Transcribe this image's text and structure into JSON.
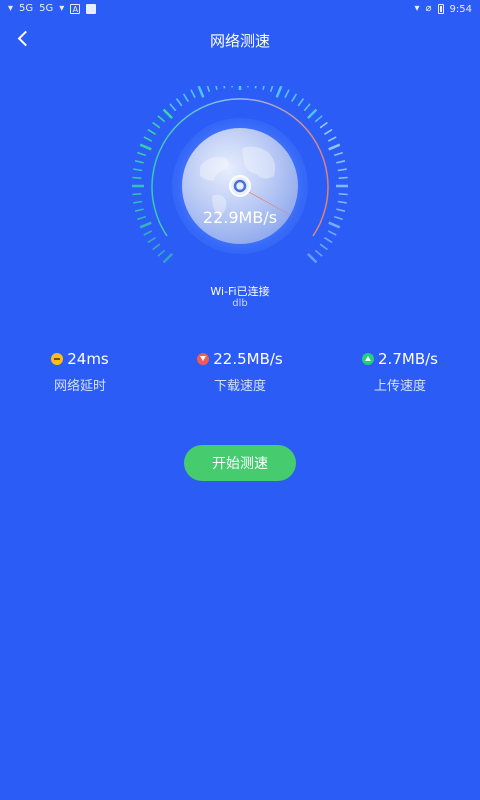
{
  "status_bar": {
    "network_1": "5G",
    "network_2": "5G",
    "time": "9:54"
  },
  "header": {
    "title": "网络测速"
  },
  "gauge": {
    "speed_text": "22.9MB/s",
    "colors": {
      "arc_start": "#37e0a0",
      "arc_end": "#ff8a5a",
      "needle": "#ff5a2e"
    }
  },
  "connection": {
    "status": "Wi-Fi已连接",
    "ssid": "dlb"
  },
  "stats": [
    {
      "value": "24ms",
      "label": "网络延时",
      "icon": "latency-icon"
    },
    {
      "value": "22.5MB/s",
      "label": "下载速度",
      "icon": "download-icon"
    },
    {
      "value": "2.7MB/s",
      "label": "上传速度",
      "icon": "upload-icon"
    }
  ],
  "actions": {
    "start_label": "开始测速"
  },
  "colors": {
    "background": "#2b5cf5",
    "button": "#46cc6f"
  }
}
